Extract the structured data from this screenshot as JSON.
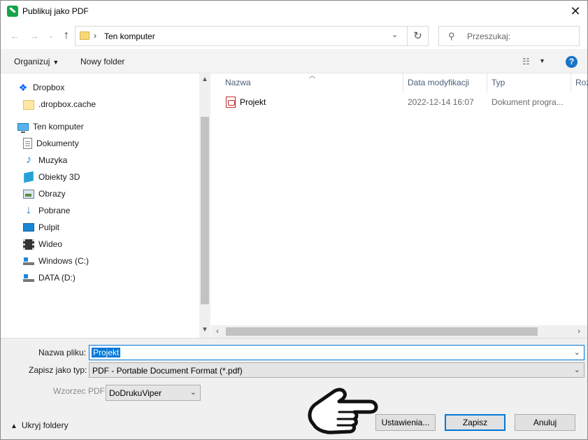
{
  "window": {
    "title": "Publikuj jako PDF"
  },
  "icons": {
    "app": "pdf-app-icon",
    "close": "close-icon",
    "back": "arrow-left-icon",
    "forward": "arrow-right-icon",
    "recent": "chevron-down-icon",
    "up": "arrow-up-icon",
    "refresh": "refresh-icon",
    "search": "search-icon",
    "help": "help-icon",
    "hand": "pointing-hand-icon"
  },
  "address": {
    "path": "Ten komputer"
  },
  "search": {
    "placeholder": "Przeszukaj:"
  },
  "toolbar": {
    "organize": "Organizuj",
    "new_folder": "Nowy folder",
    "help": "?"
  },
  "navigation": {
    "items": [
      {
        "label": "Dropbox",
        "icon": "dropbox-icon"
      },
      {
        "label": ".dropbox.cache",
        "icon": "folder-icon"
      },
      {
        "label": "Ten komputer",
        "icon": "computer-icon"
      },
      {
        "label": "Dokumenty",
        "icon": "documents-icon"
      },
      {
        "label": "Muzyka",
        "icon": "music-icon"
      },
      {
        "label": "Obiekty 3D",
        "icon": "3d-objects-icon"
      },
      {
        "label": "Obrazy",
        "icon": "pictures-icon"
      },
      {
        "label": "Pobrane",
        "icon": "downloads-icon"
      },
      {
        "label": "Pulpit",
        "icon": "desktop-icon"
      },
      {
        "label": "Wideo",
        "icon": "video-icon"
      },
      {
        "label": "Windows (C:)",
        "icon": "drive-icon"
      },
      {
        "label": "DATA (D:)",
        "icon": "drive-icon"
      }
    ]
  },
  "files": {
    "columns": [
      "Nazwa",
      "Data modyfikacji",
      "Typ",
      "Roz"
    ],
    "rows": [
      {
        "name": "Projekt",
        "modified": "2022-12-14 16:07",
        "type": "Dokument progra...",
        "icon": "pdf-file-icon"
      }
    ]
  },
  "form": {
    "filename_label": "Nazwa pliku:",
    "filename_value": "Projekt",
    "savetype_label": "Zapisz jako typ:",
    "savetype_value": "PDF - Portable Document Format (*.pdf)",
    "template_label": "Wzorzec PDF:",
    "template_value": "DoDrukuViper"
  },
  "footer": {
    "hide_folders": "Ukryj foldery",
    "settings_button": "Ustawienia...",
    "save_button": "Zapisz",
    "cancel_button": "Anuluj"
  },
  "colors": {
    "accent": "#0078d7",
    "help": "#1a73c7",
    "bottom_bg": "#f0f0f0"
  }
}
